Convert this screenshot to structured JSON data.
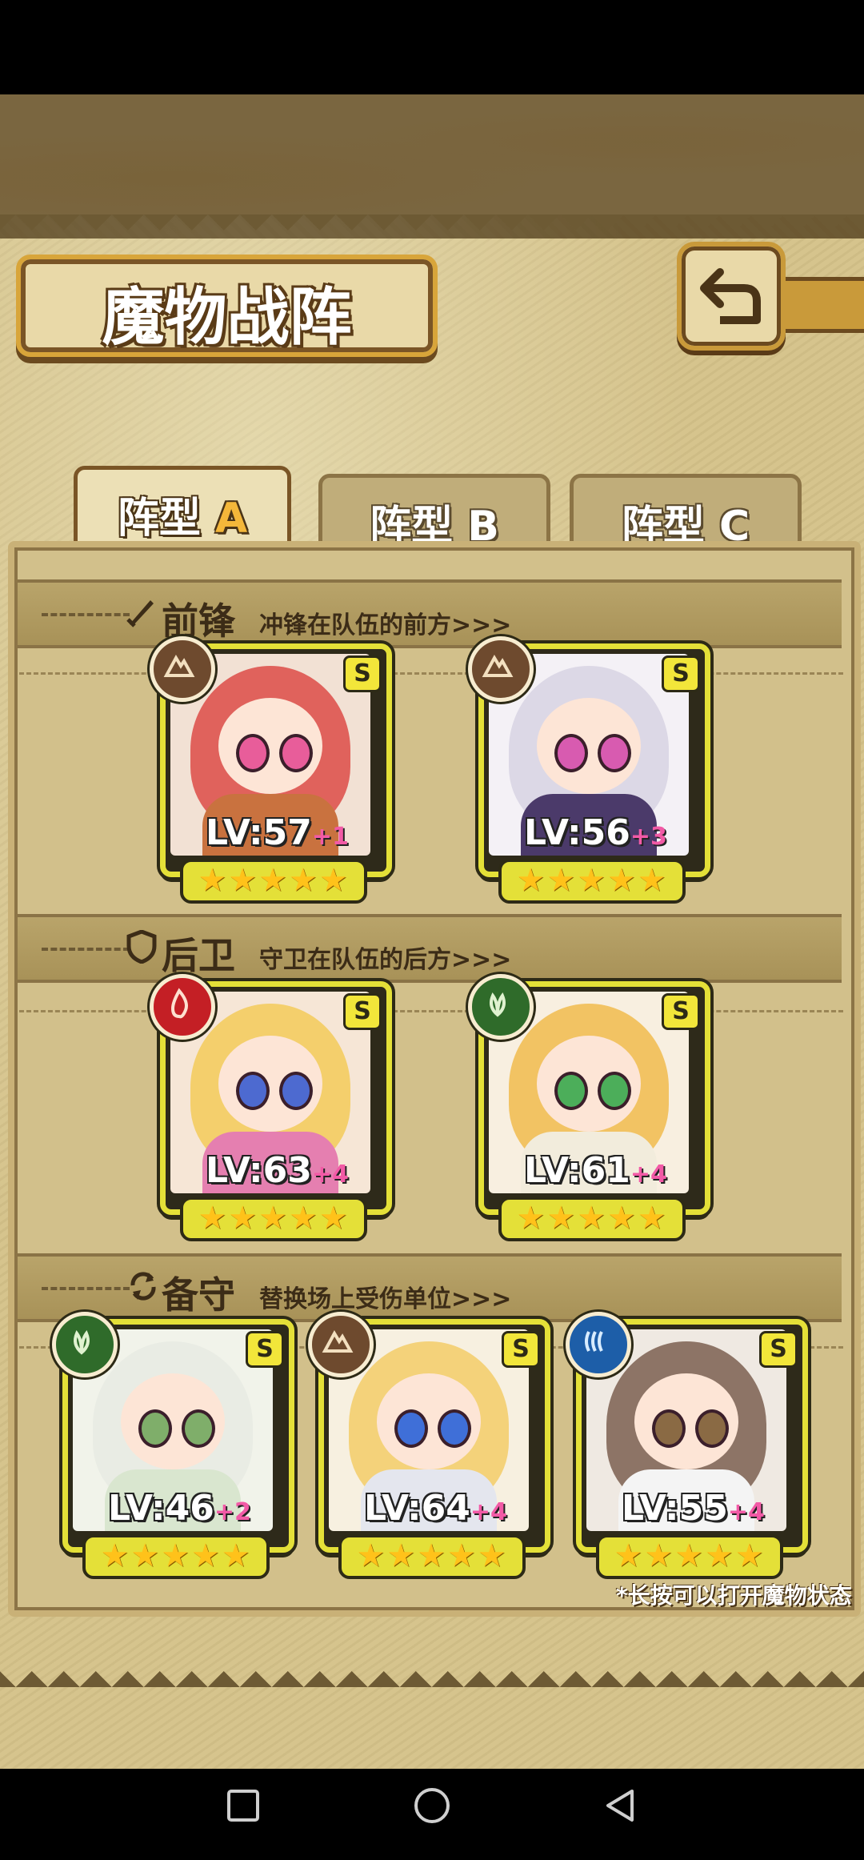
{
  "colors": {
    "accent": "#e4e038",
    "parchment": "#d6c48d",
    "frame": "#c9b177",
    "tab_active_letter": "#f4b73a",
    "level_plus": "#f25aa6"
  },
  "title": "魔物战阵",
  "back_icon": "return-arrow-icon",
  "tabs": [
    {
      "label": "阵型",
      "letter": "A",
      "active": true
    },
    {
      "label": "阵型",
      "letter": "B",
      "active": false
    },
    {
      "label": "阵型",
      "letter": "C",
      "active": false
    }
  ],
  "sections": {
    "front": {
      "title": "前锋",
      "desc": "冲锋在队伍的前方>>>",
      "icon": "sword-icon"
    },
    "rear": {
      "title": "后卫",
      "desc": "守卫在队伍的后方>>>",
      "icon": "shield-icon"
    },
    "reserve": {
      "title": "备守",
      "desc": "替换场上受伤单位>>>",
      "icon": "swap-icon"
    }
  },
  "cards": {
    "front": [
      {
        "level": "LV:57",
        "plus": "+1",
        "rank": "S",
        "stars": "★★★★★",
        "element": "earth"
      },
      {
        "level": "LV:56",
        "plus": "+3",
        "rank": "S",
        "stars": "★★★★★",
        "element": "earth"
      }
    ],
    "rear": [
      {
        "level": "LV:63",
        "plus": "+4",
        "rank": "S",
        "stars": "★★★★★",
        "element": "fire"
      },
      {
        "level": "LV:61",
        "plus": "+4",
        "rank": "S",
        "stars": "★★★★★",
        "element": "wood"
      }
    ],
    "reserve": [
      {
        "level": "LV:46",
        "plus": "+2",
        "rank": "S",
        "stars": "★★★★★",
        "element": "wood"
      },
      {
        "level": "LV:64",
        "plus": "+4",
        "rank": "S",
        "stars": "★★★★★",
        "element": "earth"
      },
      {
        "level": "LV:55",
        "plus": "+4",
        "rank": "S",
        "stars": "★★★★★",
        "element": "water"
      }
    ]
  },
  "footnote": "*长按可以打开魔物状态",
  "nav": {
    "recents": "square-icon",
    "home": "circle-icon",
    "back": "triangle-back-icon"
  }
}
